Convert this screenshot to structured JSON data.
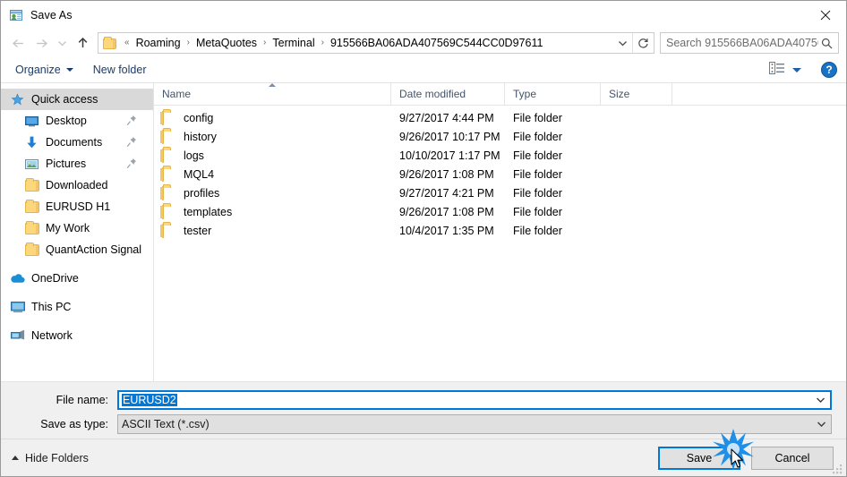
{
  "window": {
    "title": "Save As",
    "icon": "save-as-window-icon",
    "close_label": "✕"
  },
  "nav": {
    "back_icon": "arrow-left-icon",
    "forward_icon": "arrow-right-icon",
    "recent_icon": "chevron-down-icon",
    "up_icon": "arrow-up-icon",
    "folder_icon": "folder-icon",
    "breadcrumb_leading": "«",
    "breadcrumbs": [
      "Roaming",
      "MetaQuotes",
      "Terminal",
      "915566BA06ADA407569C544CC0D97611"
    ],
    "separator": "›",
    "dropdown_icon": "chevron-down-icon",
    "refresh_icon": "refresh-icon"
  },
  "search": {
    "placeholder": "Search 915566BA06ADA40756...",
    "value": "",
    "icon": "search-icon"
  },
  "toolbar": {
    "organize_label": "Organize",
    "new_folder_label": "New folder",
    "view_icon": "view-options-icon",
    "help_label": "?",
    "help_icon": "help-icon"
  },
  "sidebar": {
    "items": [
      {
        "label": "Quick access",
        "icon": "star-icon",
        "selected": true,
        "indent": false,
        "pinned": false,
        "group": false
      },
      {
        "label": "Desktop",
        "icon": "desktop-icon",
        "selected": false,
        "indent": true,
        "pinned": true,
        "group": false
      },
      {
        "label": "Documents",
        "icon": "documents-icon",
        "selected": false,
        "indent": true,
        "pinned": true,
        "group": false
      },
      {
        "label": "Pictures",
        "icon": "pictures-icon",
        "selected": false,
        "indent": true,
        "pinned": true,
        "group": false
      },
      {
        "label": "Downloaded",
        "icon": "folder-icon",
        "selected": false,
        "indent": true,
        "pinned": false,
        "group": false
      },
      {
        "label": "EURUSD H1",
        "icon": "folder-icon",
        "selected": false,
        "indent": true,
        "pinned": false,
        "group": false
      },
      {
        "label": "My Work",
        "icon": "folder-icon",
        "selected": false,
        "indent": true,
        "pinned": false,
        "group": false
      },
      {
        "label": "QuantAction Signal",
        "icon": "folder-icon",
        "selected": false,
        "indent": true,
        "pinned": false,
        "group": false
      },
      {
        "label": "OneDrive",
        "icon": "onedrive-icon",
        "selected": false,
        "indent": false,
        "pinned": false,
        "group": true
      },
      {
        "label": "This PC",
        "icon": "this-pc-icon",
        "selected": false,
        "indent": false,
        "pinned": false,
        "group": true
      },
      {
        "label": "Network",
        "icon": "network-icon",
        "selected": false,
        "indent": false,
        "pinned": false,
        "group": true
      }
    ]
  },
  "filelist": {
    "columns": [
      "Name",
      "Date modified",
      "Type",
      "Size"
    ],
    "sort_column": "Name",
    "sort_direction": "ascending",
    "rows": [
      {
        "name": "config",
        "date": "9/27/2017 4:44 PM",
        "type": "File folder",
        "size": ""
      },
      {
        "name": "history",
        "date": "9/26/2017 10:17 PM",
        "type": "File folder",
        "size": ""
      },
      {
        "name": "logs",
        "date": "10/10/2017 1:17 PM",
        "type": "File folder",
        "size": ""
      },
      {
        "name": "MQL4",
        "date": "9/26/2017 1:08 PM",
        "type": "File folder",
        "size": ""
      },
      {
        "name": "profiles",
        "date": "9/27/2017 4:21 PM",
        "type": "File folder",
        "size": ""
      },
      {
        "name": "templates",
        "date": "9/26/2017 1:08 PM",
        "type": "File folder",
        "size": ""
      },
      {
        "name": "tester",
        "date": "10/4/2017 1:35 PM",
        "type": "File folder",
        "size": ""
      }
    ]
  },
  "form": {
    "filename_label": "File name:",
    "filename_value": "EURUSD2",
    "filetype_label": "Save as type:",
    "filetype_value": "ASCII Text (*.csv)",
    "dropdown_icon": "chevron-down-icon"
  },
  "footer": {
    "hide_folders_label": "Hide Folders",
    "save_label": "Save",
    "cancel_label": "Cancel",
    "resize_grip_icon": "resize-grip-icon"
  },
  "colors": {
    "accent": "#0078d7",
    "folder": "#fcd77b",
    "header_text": "#44546a",
    "toolbar_text": "#1a3c6e",
    "selection": "#d9d9d9",
    "click_burst": "#1f8fe8"
  }
}
